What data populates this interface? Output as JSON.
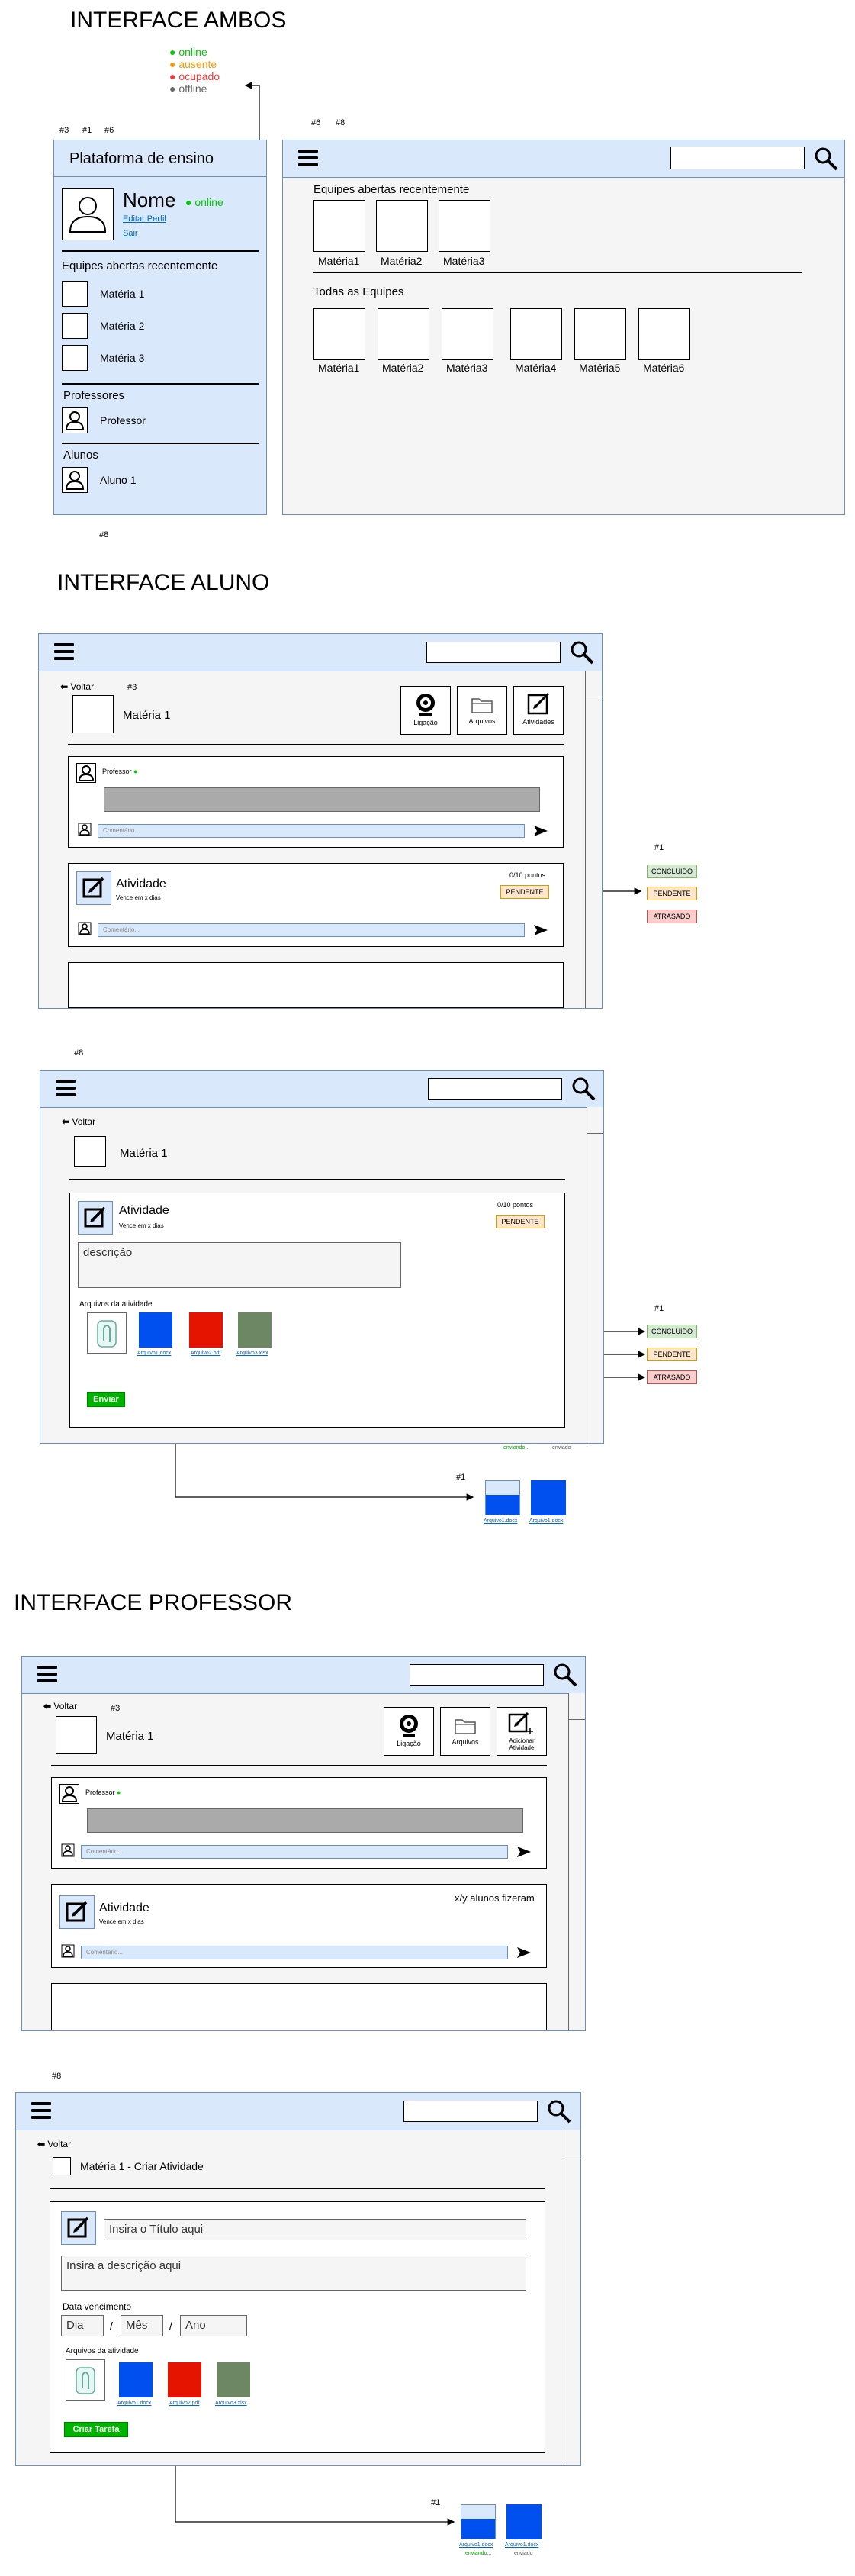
{
  "ambos": {
    "title": "INTERFACE AMBOS",
    "legend": [
      {
        "label": "online",
        "color": "#00cc00"
      },
      {
        "label": "ausente",
        "color": "#ff9900"
      },
      {
        "label": "ocupado",
        "color": "#ff3333"
      },
      {
        "label": "offline",
        "color": "#666666"
      }
    ],
    "tag_left": [
      "#3",
      "#1",
      "#6"
    ],
    "tag_right": [
      "#6",
      "#8"
    ],
    "tag_bottom": "#8",
    "sidebar": {
      "title": "Plataforma de ensino",
      "user_name": "Nome",
      "user_status": "online",
      "edit_profile": "Editar Perfil",
      "logout": "Sair",
      "teams_heading": "Equipes abertas recentemente",
      "teams": [
        "Matéria 1",
        "Matéria 2",
        "Matéria 3"
      ],
      "teachers_heading": "Professores",
      "teacher": "Professor",
      "students_heading": "Alunos",
      "student": "Aluno 1"
    },
    "main": {
      "recent_heading": "Equipes abertas recentemente",
      "recent": [
        "Matéria1",
        "Matéria2",
        "Matéria3"
      ],
      "all_heading": "Todas as Equipes",
      "all": [
        "Matéria1",
        "Matéria2",
        "Matéria3",
        "Matéria4",
        "Matéria5",
        "Matéria6"
      ]
    }
  },
  "aluno": {
    "title": "INTERFACE ALUNO",
    "back": "Voltar",
    "tag3": "#3",
    "subject": "Matéria 1",
    "tools": [
      "Ligação",
      "Arquivos",
      "Atividades"
    ],
    "post_author": "Professor",
    "comment_placeholder": "Comentário...",
    "activity_title": "Atividade",
    "activity_due": "Vence em x dias",
    "activity_points": "0/10 pontos",
    "activity_status": "PENDENTE",
    "status_tag": "#1",
    "statuses": [
      "CONCLUÍDO",
      "PENDENTE",
      "ATRASADO"
    ]
  },
  "aluno2": {
    "tag": "#8",
    "back": "Voltar",
    "subject": "Matéria 1",
    "activity_title": "Atividade",
    "activity_due": "Vence em x dias",
    "activity_points": "0/10 pontos",
    "activity_status": "PENDENTE",
    "description": "descrição",
    "files_heading": "Arquivos da atividade",
    "files": [
      "Arquivo1.docx",
      "Arquivo2.pdf",
      "Arquivo3.xlsx"
    ],
    "send": "Enviar",
    "status_tag": "#1",
    "statuses": [
      "CONCLUÍDO",
      "PENDENTE",
      "ATRASADO"
    ],
    "upload_labels": [
      "enviando...",
      "enviado"
    ],
    "upload_tag": "#1",
    "upload_files": [
      "Arquivo1.docx",
      "Arquivo1.docx"
    ]
  },
  "professor": {
    "title": "INTERFACE PROFESSOR",
    "back": "Voltar",
    "tag3": "#3",
    "subject": "Matéria 1",
    "tools": [
      "Ligação",
      "Arquivos",
      "Adicionar Atividade"
    ],
    "post_author": "Professor",
    "comment_placeholder": "Comentário...",
    "activity_title": "Atividade",
    "activity_due": "Vence em x dias",
    "activity_count": "x/y alunos fizeram"
  },
  "professor2": {
    "tag": "#8",
    "back": "Voltar",
    "subject": "Matéria 1 - Criar Atividade",
    "title_placeholder": "Insira o Título aqui",
    "desc_placeholder": "Insira a descrição aqui",
    "due_label": "Data vencimento",
    "day": "Dia",
    "month": "Mês",
    "year": "Ano",
    "sep": "/",
    "files_heading": "Arquivos da atividade",
    "files": [
      "Arquivo1.docx",
      "Arquivo2.pdf",
      "Arquivo3.xlsx"
    ],
    "create": "Criar Tarefa",
    "upload_tag": "#1",
    "upload_files": [
      "Arquivo1.docx",
      "Arquivo1.docx"
    ],
    "upload_labels": [
      "enviando...",
      "enviado"
    ]
  }
}
